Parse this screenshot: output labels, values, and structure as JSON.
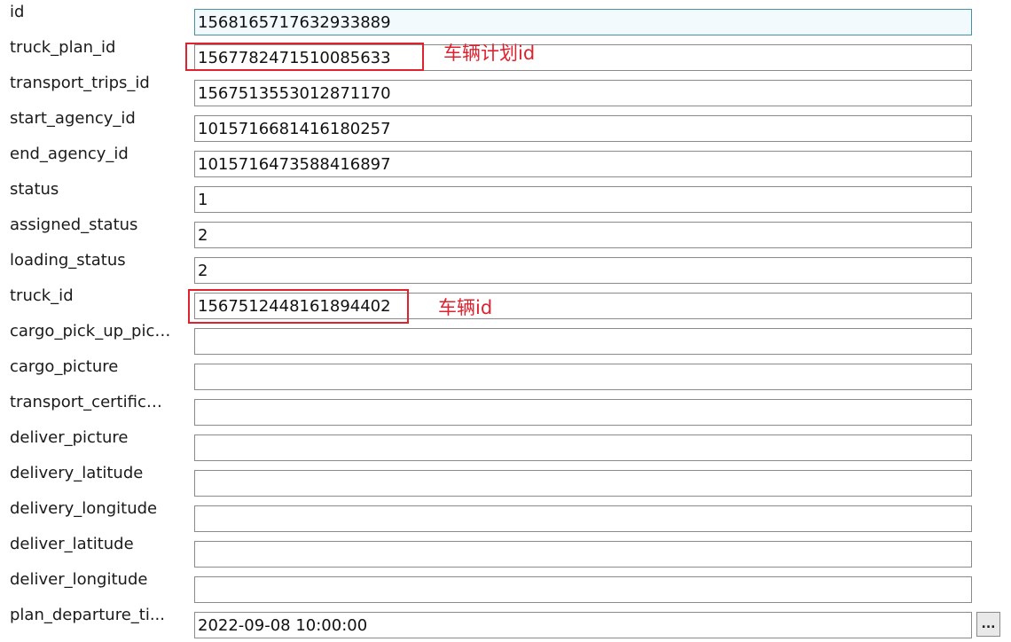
{
  "fields": [
    {
      "label": "id",
      "value": "1568165717632933889"
    },
    {
      "label": "truck_plan_id",
      "value": "1567782471510085633"
    },
    {
      "label": "transport_trips_id",
      "value": "1567513553012871170"
    },
    {
      "label": "start_agency_id",
      "value": "1015716681416180257"
    },
    {
      "label": "end_agency_id",
      "value": "1015716473588416897"
    },
    {
      "label": "status",
      "value": "1"
    },
    {
      "label": "assigned_status",
      "value": "2"
    },
    {
      "label": "loading_status",
      "value": "2"
    },
    {
      "label": "truck_id",
      "value": "1567512448161894402"
    },
    {
      "label": "cargo_pick_up_pict...",
      "value": ""
    },
    {
      "label": "cargo_picture",
      "value": ""
    },
    {
      "label": "transport_certificate",
      "value": ""
    },
    {
      "label": "deliver_picture",
      "value": ""
    },
    {
      "label": "delivery_latitude",
      "value": ""
    },
    {
      "label": "delivery_longitude",
      "value": ""
    },
    {
      "label": "deliver_latitude",
      "value": ""
    },
    {
      "label": "deliver_longitude",
      "value": ""
    },
    {
      "label": "plan_departure_ti...",
      "value": "2022-09-08 10:00:00"
    }
  ],
  "picker_button_label": "...",
  "annotations": {
    "truck_plan": "车辆计划id",
    "truck": "车辆id"
  },
  "colors": {
    "annotation": "#e0212e",
    "field_border": "#8a8a8a",
    "active_field_bg": "#f3fafd"
  }
}
